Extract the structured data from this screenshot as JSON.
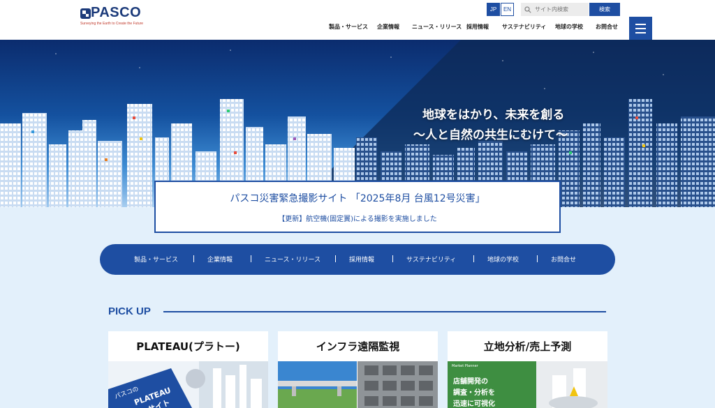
{
  "header": {
    "logo_text": "PASCO",
    "logo_tagline": "Surveying the Earth to Create the Future",
    "lang_jp": "JP",
    "lang_en": "EN",
    "search_placeholder": "サイト内検索",
    "search_button": "検索",
    "nav": [
      "製品・サービス",
      "企業情報",
      "ニュース・リリース",
      "採用情報",
      "サステナビリティ",
      "地球の学校",
      "お問合せ"
    ]
  },
  "hero": {
    "line1": "地球をはかり、未来を創る",
    "line2": "〜人と自然の共生にむけて〜"
  },
  "notice": {
    "title": "パスコ災害緊急撮影サイト 「2025年8月 台風12号災害」",
    "subtitle": "【更新】航空機(固定翼)による撮影を実施しました"
  },
  "pill_nav": [
    "製品・サービス",
    "企業情報",
    "ニュース・リリース",
    "採用情報",
    "サステナビリティ",
    "地球の学校",
    "お問合せ"
  ],
  "pickup": {
    "label": "PICK UP",
    "cards": [
      {
        "title": "PLATEAU(プラトー)",
        "img_text1": "パスコの",
        "img_text2": "PLATEAU",
        "img_text3": "サイト"
      },
      {
        "title": "インフラ遠隔監視"
      },
      {
        "title": "立地分析/売上予測",
        "img_brand": "Market Planner",
        "img_text1": "店舗開発の",
        "img_text2": "調査・分析を",
        "img_text3": "迅速に可視化"
      }
    ]
  },
  "colors": {
    "brand_blue": "#1e4ea2",
    "logo_red": "#c0392b",
    "page_bg": "#e3f0fb"
  }
}
